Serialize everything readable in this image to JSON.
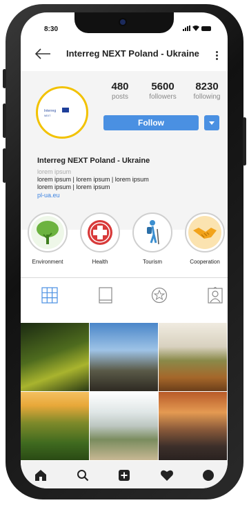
{
  "status": {
    "time": "8:30"
  },
  "header": {
    "title": "Interreg NEXT Poland - Ukraine"
  },
  "avatar": {
    "logo_text": "Interreg",
    "logo_sub": "NEXT"
  },
  "stats": [
    {
      "value": "480",
      "label": "posts"
    },
    {
      "value": "5600",
      "label": "followers"
    },
    {
      "value": "8230",
      "label": "following"
    }
  ],
  "follow_label": "Follow",
  "bio": {
    "name": "Interreg NEXT Poland - Ukraine",
    "category": "lorem ipsum",
    "line1": "lorem ipsum  | lorem ipsum | lorem ipsum",
    "line2": "lorem ipsum | lorem ipsum",
    "link": "pl-ua.eu"
  },
  "highlights": [
    {
      "label": "Environment",
      "icon": "tree-icon"
    },
    {
      "label": "Health",
      "icon": "medical-cross-icon"
    },
    {
      "label": "Tourism",
      "icon": "hiker-icon"
    },
    {
      "label": "Cooperation",
      "icon": "handshake-icon"
    }
  ],
  "tabs": [
    "grid-icon",
    "reels-icon",
    "star-icon",
    "tagged-icon"
  ],
  "nav": [
    "home-icon",
    "search-icon",
    "add-icon",
    "heart-icon",
    "profile-icon"
  ],
  "colors": {
    "accent": "#4a90e2",
    "ring": "#f2c200",
    "link": "#3b82e0"
  }
}
